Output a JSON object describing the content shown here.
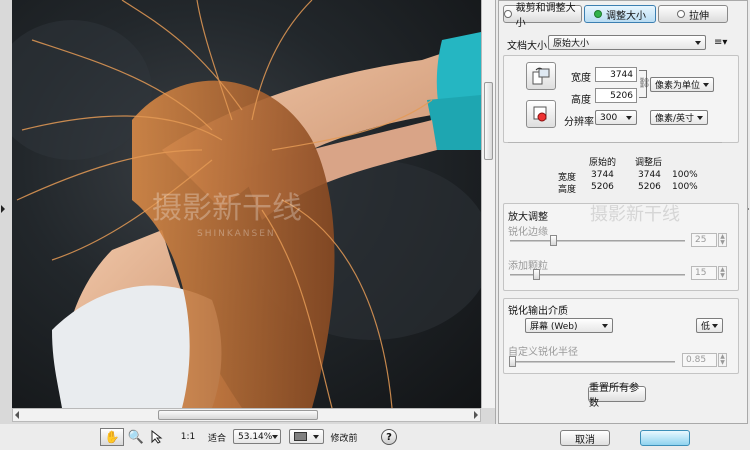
{
  "tabs": [
    {
      "label": "裁剪和调整大小"
    },
    {
      "label": "调整大小"
    },
    {
      "label": "拉伸"
    }
  ],
  "doc_size": {
    "label": "文档大小",
    "value": "原始大小"
  },
  "width": {
    "label": "宽度",
    "value": "3744",
    "unit": "像素为单位"
  },
  "height": {
    "label": "高度",
    "value": "5206"
  },
  "resolution": {
    "label": "分辨率",
    "value": "300",
    "unit": "像素/英寸"
  },
  "compare": {
    "col_original": "原始的",
    "col_after": "调整后",
    "rows": [
      {
        "label": "宽度",
        "original": "3744",
        "after": "3744",
        "pct": "100%"
      },
      {
        "label": "高度",
        "original": "5206",
        "after": "5206",
        "pct": "100%"
      }
    ]
  },
  "enlarge": {
    "title": "放大调整",
    "sharpen_edges": {
      "label": "锐化边缘",
      "value": "25"
    },
    "add_grain": {
      "label": "添加颗粒",
      "value": "15"
    }
  },
  "output": {
    "title": "锐化输出介质",
    "medium": "屏幕 (Web)",
    "level": "低",
    "radius": {
      "label": "自定义锐化半径",
      "value": "0.85"
    }
  },
  "reset_label": "重置所有参数",
  "cancel_label": "取消",
  "toolbar": {
    "zoom_ratio": "1:1",
    "fit": "适合",
    "zoom": "53.14%",
    "before": "修改前"
  },
  "watermark": {
    "main": "摄影新干线",
    "sub": "SHINKANSEN"
  }
}
